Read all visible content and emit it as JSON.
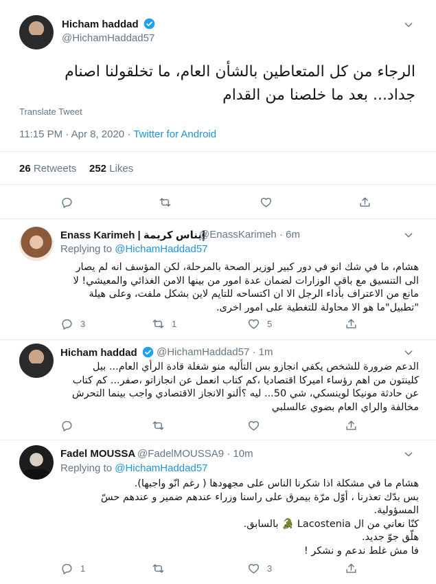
{
  "main": {
    "name": "Hicham haddad",
    "handle": "@HichamHaddad57",
    "text_line1": "الرجاء من كل المتعاطين بالشأن العام، ما تخلقولنا اصنام",
    "text_line2": "جداد... بعد ما خلصنا من القدام",
    "translate": "Translate Tweet",
    "timestamp": "11:15 PM · Apr 8, 2020 · ",
    "source": "Twitter for Android",
    "retweets_count": "26",
    "retweets_label": "Retweets",
    "likes_count": "252",
    "likes_label": "Likes"
  },
  "replies": [
    {
      "name": "Enass Karimeh | إيناس كريمة",
      "handle": "@EnassKarimeh · 6m",
      "replying_prefix": "Replying to ",
      "replying_to": "@HichamHaddad57",
      "lines": [
        "هشام، ما في شك انو في دور كبير لوزير الصحة بالمرحلة، لكن المؤسف انه لم يصار",
        "الى التنسيق مع باقي الوزارات لضمان عدة امور من بينها الامن الغذائي والمعيشي! لا",
        "مانع من الاعتراف بأداء الرجل الا ان اكتساحه للتايم لاين بشكل ملفت، وعلى هيلة",
        "\"تطبيل\"ما هو الا محاولة للتغطية على امور اخرى."
      ],
      "reply_count": "3",
      "retweet_count": "1",
      "like_count": "5"
    },
    {
      "name": "Hicham haddad",
      "handle": "@HichamHaddad57 · 1m",
      "lines": [
        "الدعم ضرورة للشخص يكفي انجازو بس التأليه منو شغلة قادة الرأي العام... بيل",
        "كلينتون من اهم رؤساء اميركا اقتصاديا ،كم كتاب انعمل عن انجازاتو ،صفر... كم كتاب",
        "عن حادثة مونيكا لوينسكي، شي 50... ليه ؟ألنو الانجاز الاقتصادي واجب بينما التحرش",
        "مخالفة والراي العام بضوي عالسلبي"
      ],
      "reply_count": "",
      "retweet_count": "",
      "like_count": ""
    },
    {
      "name": "Fadel MOUSSA",
      "handle": "@FadelMOUSSA9 · 10m",
      "replying_prefix": "Replying to ",
      "replying_to": "@HichamHaddad57",
      "lines": [
        "هشام ما في مشكلة اذا شكرنا الناس على مجهودها ( رغم انّو واجبها).",
        "بس بدّك تعذرنا ، أوّل مرّة بيمرق على راسنا وزراء عندهم ضمير و عندهم حسّ",
        "المسؤولية.",
        "كنّا نعاني من ال Lacostenia 🐊 بالسابق.",
        "هلّق جوّ جديد.",
        "فا مش غلط ندعم و نشكر !"
      ],
      "reply_count": "1",
      "retweet_count": "",
      "like_count": "3"
    }
  ],
  "colors": {
    "accent": "#1da1f2",
    "muted": "#657786",
    "text": "#14171a",
    "divider": "#e6ecf0"
  }
}
